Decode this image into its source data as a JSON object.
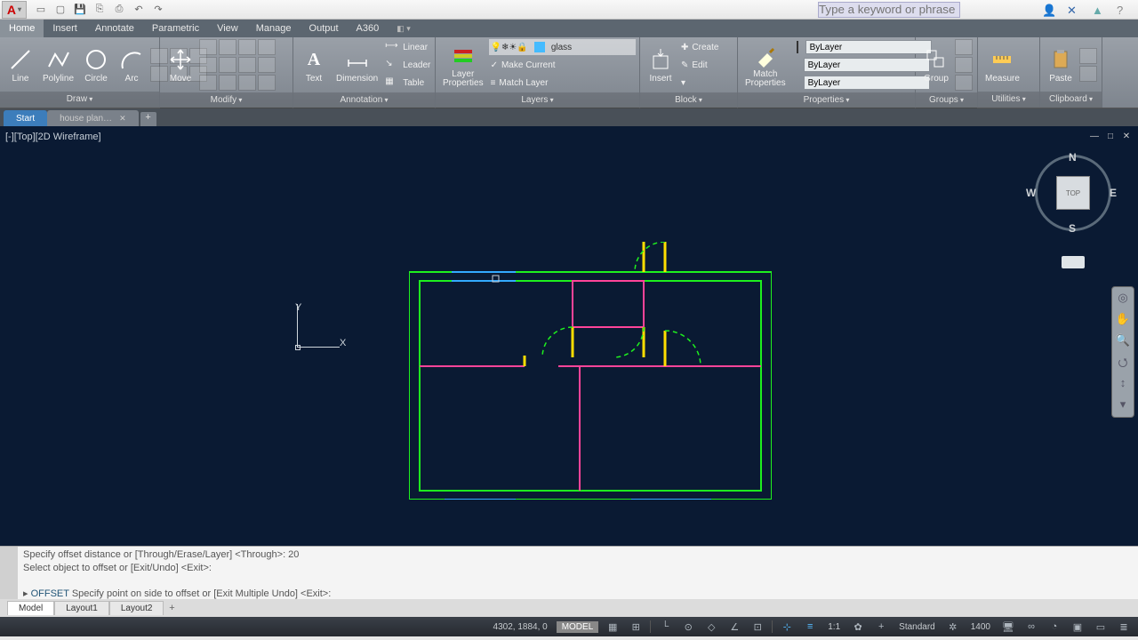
{
  "qat": {
    "search_placeholder": "Type a keyword or phrase"
  },
  "menu": {
    "app": "A",
    "tabs": [
      "Home",
      "Insert",
      "Annotate",
      "Parametric",
      "View",
      "Manage",
      "Output",
      "A360"
    ],
    "active": 0
  },
  "ribbon": {
    "draw": {
      "title": "Draw",
      "items": [
        "Line",
        "Polyline",
        "Circle",
        "Arc"
      ]
    },
    "modify": {
      "title": "Modify",
      "move": "Move"
    },
    "annotation": {
      "title": "Annotation",
      "text": "Text",
      "dim": "Dimension",
      "rows": [
        "Linear",
        "Leader",
        "Table"
      ]
    },
    "layers": {
      "title": "Layers",
      "lp": "Layer\nProperties",
      "rows": [
        "Make Current",
        "Match Layer"
      ],
      "layer_name": "glass"
    },
    "block": {
      "title": "Block",
      "insert": "Insert",
      "rows": [
        "Create",
        "Edit"
      ]
    },
    "properties": {
      "title": "Properties",
      "mp": "Match\nProperties",
      "v1": "ByLayer",
      "v2": "ByLayer",
      "v3": "ByLayer"
    },
    "groups": {
      "title": "Groups",
      "g": "Group"
    },
    "utilities": {
      "title": "Utilities",
      "m": "Measure"
    },
    "clipboard": {
      "title": "Clipboard",
      "p": "Paste"
    }
  },
  "filetabs": {
    "start": "Start",
    "second": "house plan…",
    "plus": "+"
  },
  "viewport": {
    "label": "[-][Top][2D Wireframe]",
    "cube_face": "TOP",
    "dirs": {
      "n": "N",
      "s": "S",
      "e": "E",
      "w": "W"
    },
    "ucs": {
      "x": "X",
      "y": "Y"
    }
  },
  "cmd": {
    "l1": "Specify offset distance or [Through/Erase/Layer] <Through>: 20",
    "l2": "Select object to offset or [Exit/Undo] <Exit>:",
    "l3a": "OFFSET",
    "l3b": " Specify point on side to offset or [Exit Multiple Undo] <Exit>:"
  },
  "layouts": {
    "model": "Model",
    "l1": "Layout1",
    "l2": "Layout2",
    "plus": "+"
  },
  "status": {
    "coords": "4302, 1884, 0",
    "model": "MODEL",
    "scale": "1:1",
    "std": "Standard",
    "num": "1400"
  }
}
